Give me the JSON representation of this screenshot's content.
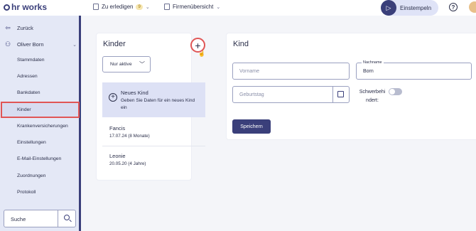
{
  "app": {
    "logo": "hr works"
  },
  "topbar": {
    "todo_label": "Zu erledigen",
    "todo_count": "9",
    "company_label": "Firmenübersicht",
    "stamp_label": "Einstempeln",
    "help_symbol": "?"
  },
  "sidebar": {
    "back_label": "Zurück",
    "user_name": "Oliver Born",
    "items": [
      {
        "label": "Stammdaten"
      },
      {
        "label": "Adressen"
      },
      {
        "label": "Bankdaten"
      },
      {
        "label": "Kinder"
      },
      {
        "label": "Krankenversicherungen"
      },
      {
        "label": "Einstellungen"
      },
      {
        "label": "E-Mail-Einstellungen"
      },
      {
        "label": "Zuordnungen"
      },
      {
        "label": "Protokoll"
      }
    ],
    "active_item": "Kinder",
    "search_placeholder": "Suche"
  },
  "kinder_panel": {
    "title": "Kinder",
    "filter_value": "Nur aktive",
    "new_child": {
      "title": "Neues Kind",
      "subtitle": "Geben Sie Daten für ein neues Kind ein"
    },
    "children": [
      {
        "name": "Fancis",
        "detail": "17.07.24 (8 Monate)"
      },
      {
        "name": "Leonie",
        "detail": "20.05.20 (4 Jahre)"
      }
    ]
  },
  "kind_form": {
    "title": "Kind",
    "vorname_placeholder": "Vorname",
    "nachname_label": "Nachname",
    "nachname_value": "Born",
    "geburtstag_placeholder": "Geburtstag",
    "schwerbehindert_label": "Schwerbehi ndert:",
    "schwerbehindert_on": false,
    "save_label": "Speichern"
  },
  "colors": {
    "primary": "#3a3f7a",
    "highlight": "#e05555",
    "sidebar_bg": "#e4e8f6"
  }
}
